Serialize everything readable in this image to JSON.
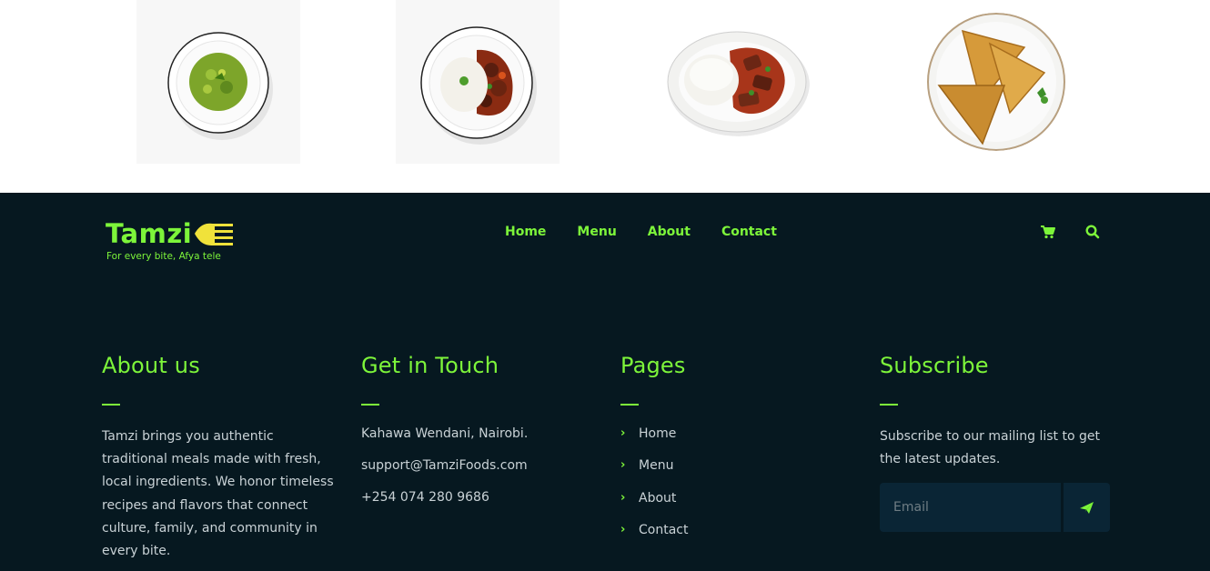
{
  "food_strip": {
    "dishes": [
      {
        "name": "green-vegetable-mash-dish"
      },
      {
        "name": "rice-and-beef-stew-dish"
      },
      {
        "name": "ugali-and-beef-stew-dish"
      },
      {
        "name": "samosa-plate-dish"
      }
    ]
  },
  "footer": {
    "logo": {
      "word": "Tamzi",
      "tagline": "For every bite, Afya tele"
    },
    "nav": {
      "items": [
        "Home",
        "Menu",
        "About",
        "Contact"
      ]
    },
    "icons": {
      "cart": "shopping-cart-icon",
      "search": "search-icon"
    },
    "about": {
      "title": "About us",
      "text": "Tamzi brings you authentic traditional meals made with fresh, local ingredients. We honor timeless recipes and flavors that connect culture, family, and community in every bite."
    },
    "contact": {
      "title": "Get in Touch",
      "address": "Kahawa Wendani, Nairobi.",
      "email": "support@TamziFoods.com",
      "phone": "+254 074 280 9686"
    },
    "pages": {
      "title": "Pages",
      "items": [
        "Home",
        "Menu",
        "About",
        "Contact"
      ]
    },
    "subscribe": {
      "title": "Subscribe",
      "text": "Subscribe to our mailing list to get the latest updates.",
      "email_placeholder": "Email",
      "email_value": "",
      "send_icon": "paper-plane-icon"
    },
    "colors": {
      "accent": "#7df53a",
      "background": "#061820",
      "text": "#c9d2d6",
      "input_bg": "#0a2535"
    }
  }
}
